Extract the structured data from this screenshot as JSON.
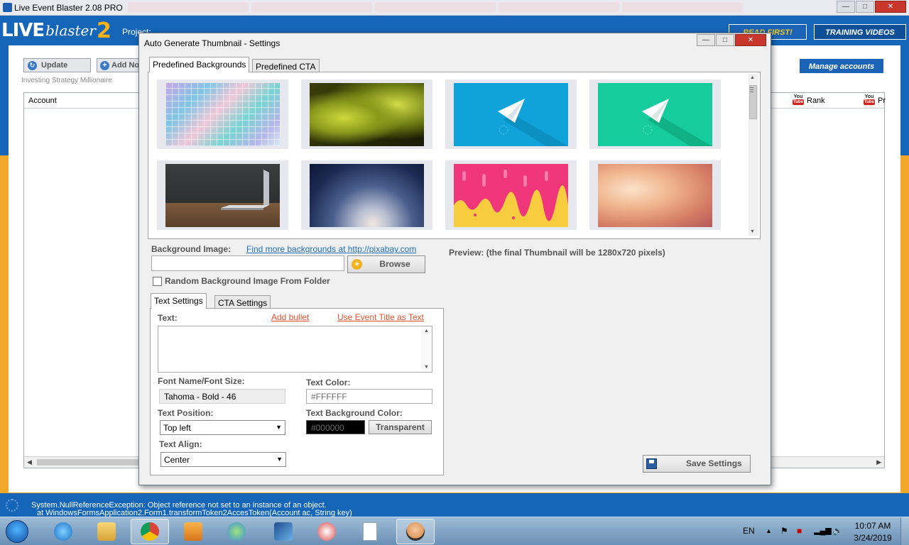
{
  "app": {
    "title": "Live Event Blaster 2.08 PRO",
    "brand_live": "LIVE",
    "brand_blaster": "blaster",
    "brand_two": "2",
    "project_label": "Project:",
    "read_first": "READ FIRST!",
    "training_videos": "TRAINING VIDEOS",
    "update_button": "Update",
    "add_button": "Add No",
    "group_label": "Investing Strategy Millionaire",
    "manage_accounts": "Manage accounts",
    "grid": {
      "col_account": "Account",
      "col_rank": "Rank",
      "col_pr": "Pr",
      "yt_you": "You",
      "yt_tube": "Tube"
    },
    "status": {
      "line1": "System.NullReferenceException: Object reference not set to an instance of an object.",
      "line2": "at WindowsFormsApplication2.Form1.transformToken2AccesToken(Account ac, String key)"
    }
  },
  "dialog": {
    "title": "Auto Generate Thumbnail - Settings",
    "bg_tabs": [
      "Predefined Backgrounds",
      "Predefined CTA"
    ],
    "backgrounds": [
      {
        "name": "grid-squares-background"
      },
      {
        "name": "yellow-green-abstract-background"
      },
      {
        "name": "blue-paper-plane-background"
      },
      {
        "name": "green-paper-plane-background"
      },
      {
        "name": "laptop-on-desk-background"
      },
      {
        "name": "dark-blue-bokeh-background"
      },
      {
        "name": "pink-yellow-drip-background"
      },
      {
        "name": "peach-blur-background"
      }
    ],
    "background_image_label": "Background Image:",
    "pixabay_link": "Find more backgrounds at http://pixabay.com",
    "background_image_value": "",
    "browse_button": "Browse",
    "random_checkbox_label": "Random Background Image From Folder",
    "random_checked": false,
    "preview_label": "Preview: (the final Thumbnail will be 1280x720 pixels)",
    "text_tabs": [
      "Text Settings",
      "CTA Settings"
    ],
    "text_label": "Text:",
    "add_bullet": "Add bullet",
    "use_event_title": "Use Event Title as Text",
    "text_value": "",
    "font_label": "Font Name/Font Size:",
    "font_value": "Tahoma - Bold - 46",
    "text_color_label": "Text Color:",
    "text_color_value": "#FFFFFF",
    "text_position_label": "Text Position:",
    "text_position_value": "Top left",
    "text_bg_color_label": "Text Background Color:",
    "text_bg_color_value": "#000000",
    "transparent_button": "Transparent",
    "text_align_label": "Text Align:",
    "text_align_value": "Center",
    "save_button": "Save Settings"
  },
  "taskbar": {
    "language": "EN",
    "time": "10:07 AM",
    "date": "3/24/2019",
    "items": [
      "internet-explorer",
      "file-explorer",
      "chrome",
      "media-player",
      "messenger",
      "network-tool",
      "snipping-tool",
      "blank-document",
      "live-event-blaster"
    ]
  },
  "colors": {
    "brand_blue": "#1565b8",
    "brand_yellow": "#f2a92a",
    "link_blue": "#1e6fb8",
    "link_red": "#e5502b"
  }
}
